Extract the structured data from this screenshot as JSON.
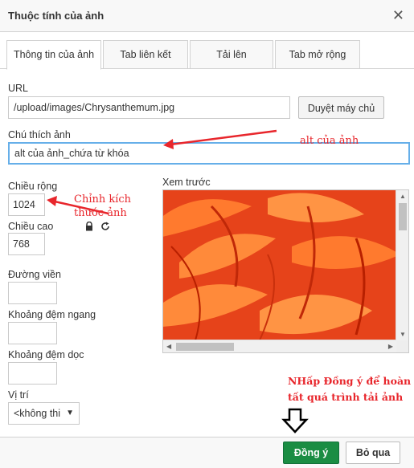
{
  "dialog": {
    "title": "Thuộc tính của ảnh",
    "close_icon": "close-icon"
  },
  "tabs": [
    {
      "label": "Thông tin của ảnh",
      "active": true
    },
    {
      "label": "Tab liên kết",
      "active": false
    },
    {
      "label": "Tải lên",
      "active": false
    },
    {
      "label": "Tab mở rộng",
      "active": false
    }
  ],
  "url": {
    "label": "URL",
    "value": "/upload/images/Chrysanthemum.jpg",
    "browse_label": "Duyệt máy chủ"
  },
  "alt": {
    "label": "Chú thích ảnh",
    "value": "alt của ảnh_chứa từ khóa"
  },
  "width": {
    "label": "Chiều rộng",
    "value": "1024"
  },
  "height": {
    "label": "Chiều cao",
    "value": "768"
  },
  "lock_icon": "lock-icon",
  "reset_icon": "reset-size-icon",
  "border": {
    "label": "Đường viền",
    "value": ""
  },
  "hspace": {
    "label": "Khoảng đệm ngang",
    "value": ""
  },
  "vspace": {
    "label": "Khoảng đệm dọc",
    "value": ""
  },
  "align": {
    "label": "Vị trí",
    "value": "<không thi"
  },
  "preview": {
    "label": "Xem trước"
  },
  "annotations": {
    "alt_note": "alt của ảnh",
    "size_note": "Chỉnh kích thước ảnh",
    "ok_note_line1": "NHấp Đồng ý để hoàn",
    "ok_note_line2": "tất quá trình tải ảnh"
  },
  "footer": {
    "ok_label": "Đồng ý",
    "cancel_label": "Bỏ qua"
  },
  "colors": {
    "ok_button": "#1a8d43",
    "annotation": "#e8262c",
    "focus_border": "#66afe9"
  }
}
